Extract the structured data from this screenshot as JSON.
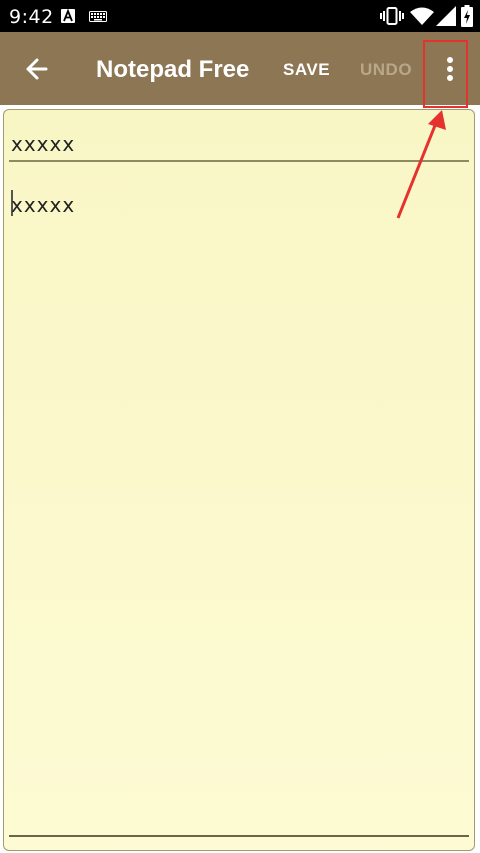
{
  "status_bar": {
    "time": "9:42",
    "icons": [
      "a-notification-icon",
      "keyboard-icon",
      "vibrate-icon",
      "wifi-icon",
      "signal-icon",
      "battery-charging-icon"
    ]
  },
  "toolbar": {
    "title": "Notepad Free",
    "save_label": "SAVE",
    "undo_label": "UNDO",
    "background_color": "#8d7654"
  },
  "note": {
    "title": "xxxxx",
    "body": "xxxxx",
    "paper_color": "#fbf9cd"
  },
  "annotation": {
    "highlight_color": "#e5322f"
  }
}
